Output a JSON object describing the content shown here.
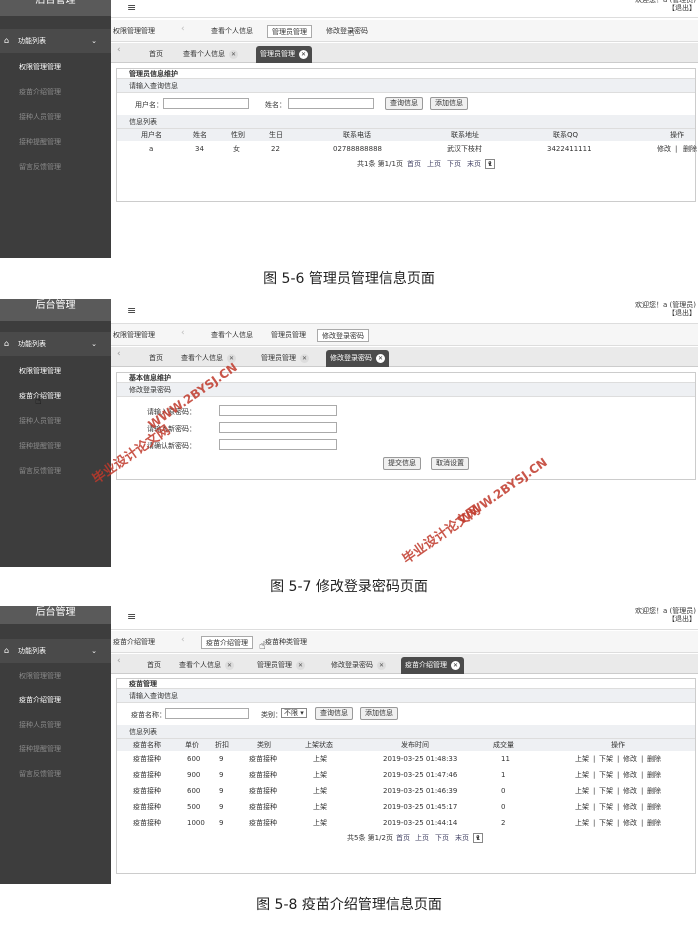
{
  "app_title": "后台管理",
  "hamburger_icon": "menu-icon",
  "sidebar": {
    "func_list": "功能列表",
    "items": [
      "权限管理管理",
      "疫苗介绍管理",
      "接种人员管理",
      "接种提醒管理",
      "留言反馈管理"
    ]
  },
  "welcome": {
    "line1": "欢迎您！a (管理员)",
    "line2": "【退出】"
  },
  "shot1": {
    "nav": {
      "crumb": "权限管理管理",
      "items": [
        "查看个人信息",
        "管理员管理",
        "修改登录密码"
      ]
    },
    "tabs": [
      "首页",
      "查看个人信息",
      "管理员管理"
    ],
    "section": "管理员信息维护",
    "query_title": "请输入查询信息",
    "q_user": "用户名：",
    "q_name": "姓名：",
    "btn_query": "查询信息",
    "btn_add": "添加信息",
    "list_title": "信息列表",
    "headers": [
      "用户名",
      "姓名",
      "性别",
      "生日",
      "联系电话",
      "联系地址",
      "联系QQ",
      "操作"
    ],
    "row": [
      "a",
      "34",
      "女",
      "22",
      "02788888888",
      "武汉下枝村",
      "3422411111",
      "修改",
      "|",
      "删除"
    ],
    "pager": {
      "info": "共1条 第1/1页",
      "first": "首页",
      "prev": "上页",
      "next": "下页",
      "last": "末页",
      "page": "1"
    },
    "caption": "图 5-6 管理员管理信息页面"
  },
  "shot2": {
    "nav": {
      "crumb": "权限管理管理",
      "items": [
        "查看个人信息",
        "管理员管理",
        "修改登录密码"
      ]
    },
    "tabs": [
      "首页",
      "查看个人信息",
      "管理员管理",
      "修改登录密码"
    ],
    "section": "基本信息维护",
    "sub": "修改登录密码",
    "labels": [
      "请输入原密码：",
      "请输入新密码：",
      "请确认新密码："
    ],
    "btn_submit": "提交信息",
    "btn_cancel": "取消设置",
    "caption": "图 5-7 修改登录密码页面"
  },
  "shot3": {
    "nav": {
      "crumb": "疫苗介绍管理",
      "items": [
        "疫苗介绍管理",
        "疫苗种类管理"
      ]
    },
    "tabs": [
      "首页",
      "查看个人信息",
      "管理员管理",
      "修改登录密码",
      "疫苗介绍管理"
    ],
    "section": "疫苗管理",
    "query_title": "请输入查询信息",
    "q_name": "疫苗名称：",
    "q_type": "类别：",
    "q_type_val": "不限",
    "btn_query": "查询信息",
    "btn_add": "添加信息",
    "list_title": "信息列表",
    "headers": [
      "疫苗名称",
      "单价",
      "折扣",
      "类别",
      "上架状态",
      "发布时间",
      "成交量",
      "操作"
    ],
    "rows": [
      [
        "疫苗接种",
        "600",
        "9",
        "疫苗接种",
        "上架",
        "2019-03-25 01:48:33",
        "11"
      ],
      [
        "疫苗接种",
        "900",
        "9",
        "疫苗接种",
        "上架",
        "2019-03-25 01:47:46",
        "1"
      ],
      [
        "疫苗接种",
        "600",
        "9",
        "疫苗接种",
        "上架",
        "2019-03-25 01:46:39",
        "0"
      ],
      [
        "疫苗接种",
        "500",
        "9",
        "疫苗接种",
        "上架",
        "2019-03-25 01:45:17",
        "0"
      ],
      [
        "疫苗接种",
        "1000",
        "9",
        "疫苗接种",
        "上架",
        "2019-03-25 01:44:14",
        "2"
      ]
    ],
    "ops": [
      "上架",
      "|",
      "下架",
      "|",
      "修改",
      "|",
      "删除"
    ],
    "pager": {
      "info": "共5条 第1/2页",
      "first": "首页",
      "prev": "上页",
      "next": "下页",
      "last": "末页",
      "page": "1"
    },
    "caption": "图 5-8 疫苗介绍管理信息页面"
  },
  "watermark": {
    "site": "WWW.2BYSJ.CN",
    "name": "毕业设计论文网"
  }
}
